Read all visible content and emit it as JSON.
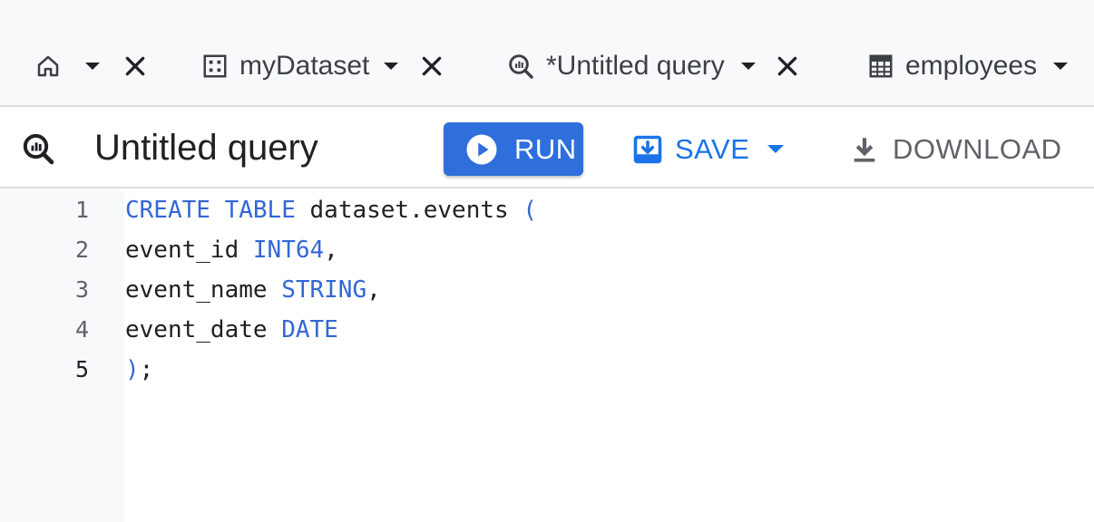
{
  "tabs": [
    {
      "icon": "home-icon",
      "label": "",
      "closable": true
    },
    {
      "icon": "dataset-icon",
      "label": "myDataset",
      "closable": true
    },
    {
      "icon": "query-icon",
      "label": "*Untitled query",
      "closable": true
    },
    {
      "icon": "table-icon",
      "label": "employees",
      "closable": false
    }
  ],
  "query": {
    "icon": "query-icon",
    "title": "Untitled query"
  },
  "toolbar": {
    "run_label": "RUN",
    "save_label": "SAVE",
    "download_label": "DOWNLOAD"
  },
  "editor": {
    "line_numbers": [
      "1",
      "2",
      "3",
      "4",
      "5"
    ],
    "active_line": "5",
    "lines": [
      [
        {
          "t": "CREATE",
          "kw": true
        },
        {
          "t": " "
        },
        {
          "t": "TABLE",
          "kw": true
        },
        {
          "t": " dataset.events "
        },
        {
          "t": "(",
          "kw": true
        }
      ],
      [
        {
          "t": "event_id "
        },
        {
          "t": "INT64",
          "kw": true
        },
        {
          "t": ","
        }
      ],
      [
        {
          "t": "event_name "
        },
        {
          "t": "STRING",
          "kw": true
        },
        {
          "t": ","
        }
      ],
      [
        {
          "t": "event_date "
        },
        {
          "t": "DATE",
          "kw": true
        }
      ],
      [
        {
          "t": ")",
          "kw": true
        },
        {
          "t": ";"
        }
      ]
    ]
  },
  "colors": {
    "accent": "#1a73e8",
    "run_button": "#2f6fdc",
    "keyword": "#3367d6",
    "tab_bar_bg": "#f8f9fa",
    "divider": "#dadce0"
  }
}
